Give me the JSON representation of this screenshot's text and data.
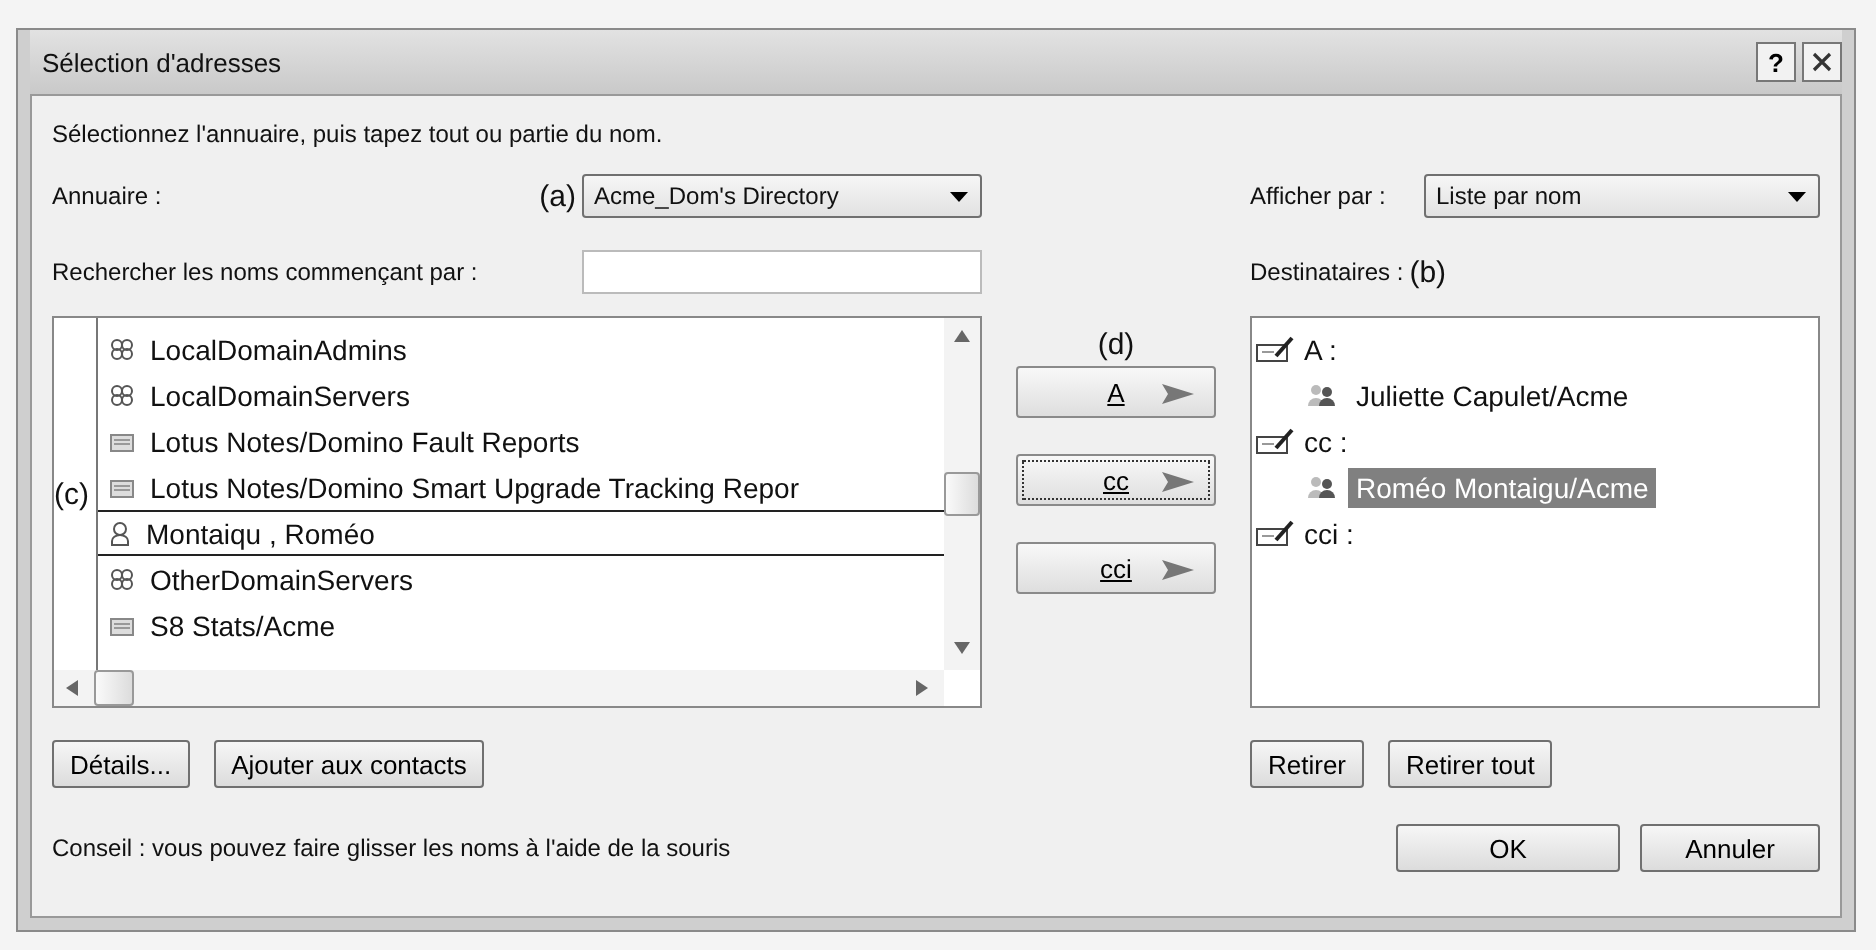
{
  "window": {
    "title": "Sélection d'adresses",
    "help": "?"
  },
  "instruction": "Sélectionnez l'annuaire, puis tapez tout ou partie du nom.",
  "directory": {
    "label": "Annuaire :",
    "annotation": "(a)",
    "value": "Acme_Dom's Directory"
  },
  "search": {
    "label": "Rechercher les noms commençant par :"
  },
  "display": {
    "label": "Afficher par :",
    "value": "Liste par nom"
  },
  "recipients_label": {
    "label": "Destinataires :",
    "annotation": "(b)"
  },
  "names_list": {
    "annotation": "(c)",
    "items": [
      {
        "label": "LocalDomainAdmins",
        "kind": "group",
        "selected": false
      },
      {
        "label": "LocalDomainServers",
        "kind": "group",
        "selected": false
      },
      {
        "label": "Lotus Notes/Domino Fault Reports",
        "kind": "database",
        "selected": false
      },
      {
        "label": "Lotus Notes/Domino Smart Upgrade Tracking Repor",
        "kind": "database",
        "selected": false
      },
      {
        "label": "Montaiqu , Roméo",
        "kind": "person",
        "selected": true
      },
      {
        "label": "OtherDomainServers",
        "kind": "group",
        "selected": false
      },
      {
        "label": "S8 Stats/Acme",
        "kind": "database",
        "selected": false
      }
    ]
  },
  "move_buttons": {
    "annotation": "(d)",
    "buttons": [
      {
        "label": "A",
        "focused": false
      },
      {
        "label": "cc",
        "focused": true
      },
      {
        "label": "cci",
        "focused": false
      }
    ]
  },
  "recipients": [
    {
      "label": "A :",
      "children": [
        {
          "label": "Juliette Capulet/Acme",
          "selected": false
        }
      ]
    },
    {
      "label": "cc :",
      "children": [
        {
          "label": "Roméo Montaigu/Acme",
          "selected": true
        }
      ]
    },
    {
      "label": "cci :"
    }
  ],
  "left_buttons": [
    "Détails...",
    "Ajouter aux contacts"
  ],
  "right_buttons": [
    "Retirer",
    "Retirer tout"
  ],
  "tip": "Conseil : vous pouvez faire glisser les noms à l'aide de la souris",
  "dialog_buttons": [
    "OK",
    "Annuler"
  ]
}
